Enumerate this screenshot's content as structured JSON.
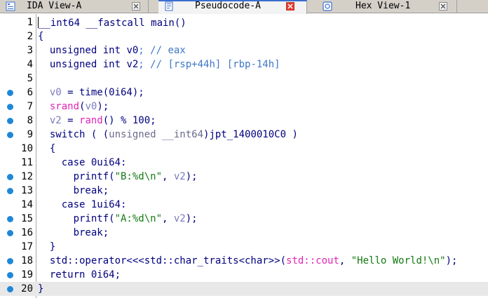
{
  "tabs": [
    {
      "label": "IDA View-A",
      "icon": "graph-view-icon",
      "active": false
    },
    {
      "label": "Pseudocode-A",
      "icon": "pseudocode-icon",
      "active": true
    },
    {
      "label": "Hex View-1",
      "icon": "hex-view-icon",
      "active": false
    }
  ],
  "colors": {
    "keyword": "#000080",
    "variable": "#7a7abf",
    "comment": "#3d78c7",
    "library_call": "#e025b5",
    "string": "#137a13",
    "breakpoint_dot": "#1e88d8",
    "active_tab_close": "#e23b2e"
  },
  "lines": [
    {
      "num": "1",
      "t": {
        "a": "__int64 __fastcall main()"
      }
    },
    {
      "num": "2",
      "t": {
        "a": "{"
      }
    },
    {
      "num": "3",
      "t": {
        "a": "  unsigned int ",
        "b": "v0",
        "c": "; // eax"
      }
    },
    {
      "num": "4",
      "t": {
        "a": "  unsigned int ",
        "b": "v2",
        "c": "; // [rsp+44h] [rbp-14h]"
      }
    },
    {
      "num": "5",
      "t": {}
    },
    {
      "num": "6",
      "t": {
        "a": "  ",
        "b": "v0",
        "c": " = time(0i64);"
      }
    },
    {
      "num": "7",
      "t": {
        "a": "  ",
        "b": "srand",
        "c": "(",
        "d": "v0",
        "e": ");"
      }
    },
    {
      "num": "8",
      "t": {
        "a": "  ",
        "b": "v2",
        "c": " = ",
        "d": "rand",
        "e": "() % 100;"
      }
    },
    {
      "num": "9",
      "t": {
        "a": "  switch ( (",
        "b": "unsigned __int64",
        "c": ")jpt_1400010C0 )"
      }
    },
    {
      "num": "10",
      "t": {
        "a": "  {"
      }
    },
    {
      "num": "11",
      "t": {
        "a": "    case 0ui64:"
      }
    },
    {
      "num": "12",
      "t": {
        "a": "      printf(",
        "b": "\"B:%d\\n\"",
        "c": ", ",
        "d": "v2",
        "e": ");"
      }
    },
    {
      "num": "13",
      "t": {
        "a": "      break;"
      }
    },
    {
      "num": "14",
      "t": {
        "a": "    case 1ui64:"
      }
    },
    {
      "num": "15",
      "t": {
        "a": "      printf(",
        "b": "\"A:%d\\n\"",
        "c": ", ",
        "d": "v2",
        "e": ");"
      }
    },
    {
      "num": "16",
      "t": {
        "a": "      break;"
      }
    },
    {
      "num": "17",
      "t": {
        "a": "  }"
      }
    },
    {
      "num": "18",
      "t": {
        "a": "  std::operator<<<std::char_traits<char>>(",
        "b": "std::cout",
        "c": ", ",
        "d": "\"Hello World!\\n\"",
        "e": ");"
      }
    },
    {
      "num": "19",
      "t": {
        "a": "  return 0i64;"
      }
    },
    {
      "num": "20",
      "t": {
        "a": "}"
      }
    }
  ]
}
